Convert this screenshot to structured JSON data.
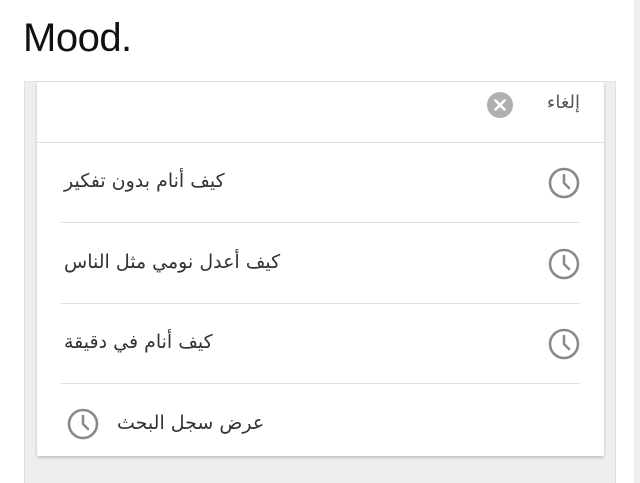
{
  "header": {
    "title": "Mood."
  },
  "search": {
    "cancel_label": "إلغاء",
    "clear_icon": "clear-x-circle-icon"
  },
  "suggestions": [
    {
      "text": "كيف أنام بدون تفكير",
      "icon": "clock-icon"
    },
    {
      "text": "كيف أعدل نومي مثل الناس",
      "icon": "clock-icon"
    },
    {
      "text": "كيف أنام في دقيقة",
      "icon": "clock-icon"
    }
  ],
  "history": {
    "label": "عرض سجل البحث",
    "icon": "clock-icon"
  },
  "colors": {
    "background": "#ffffff",
    "panel": "#eeeeee",
    "icon_gray": "#8a8a8a",
    "divider": "#e0e0e0",
    "text": "#333333"
  }
}
